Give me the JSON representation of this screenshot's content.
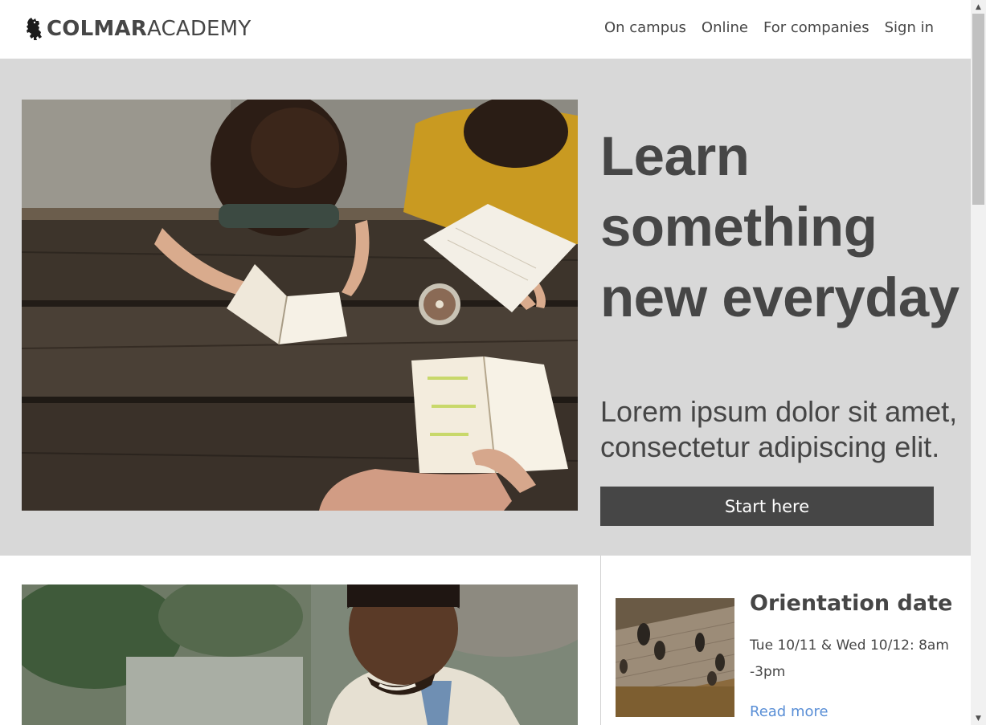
{
  "header": {
    "logo_strong": "COLMAR",
    "logo_light": "ACADEMY",
    "logo_icon": "lion-rampant-icon",
    "nav": [
      {
        "label": "On campus"
      },
      {
        "label": "Online"
      },
      {
        "label": "For companies"
      },
      {
        "label": "Sign in"
      }
    ]
  },
  "hero": {
    "title": "Learn something new everyday",
    "subtitle": "Lorem ipsum dolor sit amet, consectetur adipiscing elit.",
    "cta_label": "Start here"
  },
  "event": {
    "title": "Orientation date",
    "date": "Tue 10/11 & Wed 10/12: 8am -3pm",
    "link_label": "Read more"
  },
  "colors": {
    "text": "#464646",
    "hero_bg": "#d8d8d8",
    "button_bg": "#464646",
    "link": "#5a8fd6"
  }
}
